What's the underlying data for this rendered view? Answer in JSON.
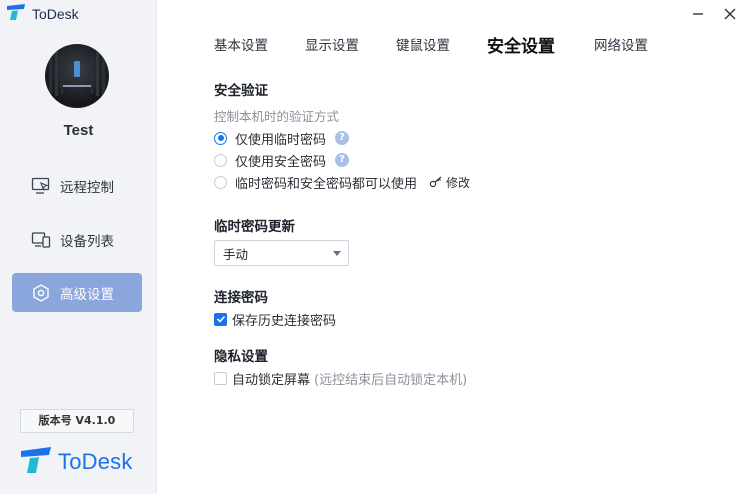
{
  "window": {
    "app_title": "ToDesk",
    "minimize_icon": "minimize-icon",
    "close_icon": "close-icon"
  },
  "sidebar": {
    "username": "Test",
    "items": [
      {
        "label": "远程控制",
        "icon": "monitor-cursor-icon",
        "active": false
      },
      {
        "label": "设备列表",
        "icon": "devices-icon",
        "active": false
      },
      {
        "label": "高级设置",
        "icon": "settings-hex-icon",
        "active": true
      }
    ],
    "version": "版本号 V4.1.0",
    "brand": "ToDesk"
  },
  "tabs": [
    {
      "label": "基本设置",
      "active": false
    },
    {
      "label": "显示设置",
      "active": false
    },
    {
      "label": "键鼠设置",
      "active": false
    },
    {
      "label": "安全设置",
      "active": true
    },
    {
      "label": "网络设置",
      "active": false
    }
  ],
  "security": {
    "title": "安全验证",
    "subtitle": "控制本机时的验证方式",
    "options": [
      {
        "label": "仅使用临时密码",
        "selected": true,
        "help": "?"
      },
      {
        "label": "仅使用安全密码",
        "selected": false,
        "help": "?"
      },
      {
        "label": "临时密码和安全密码都可以使用",
        "selected": false,
        "modify": "修改"
      }
    ]
  },
  "temp_password": {
    "title": "临时密码更新",
    "selected": "手动"
  },
  "connection_password": {
    "title": "连接密码",
    "checkbox_label": "保存历史连接密码",
    "checked": true
  },
  "privacy": {
    "title": "隐私设置",
    "checkbox_label": "自动锁定屏幕",
    "hint": "(远控结束后自动锁定本机)",
    "checked": false
  },
  "colors": {
    "accent": "#1a73e8",
    "active_nav": "#8aa6dc",
    "sidebar_bg": "#f1f3f7"
  }
}
